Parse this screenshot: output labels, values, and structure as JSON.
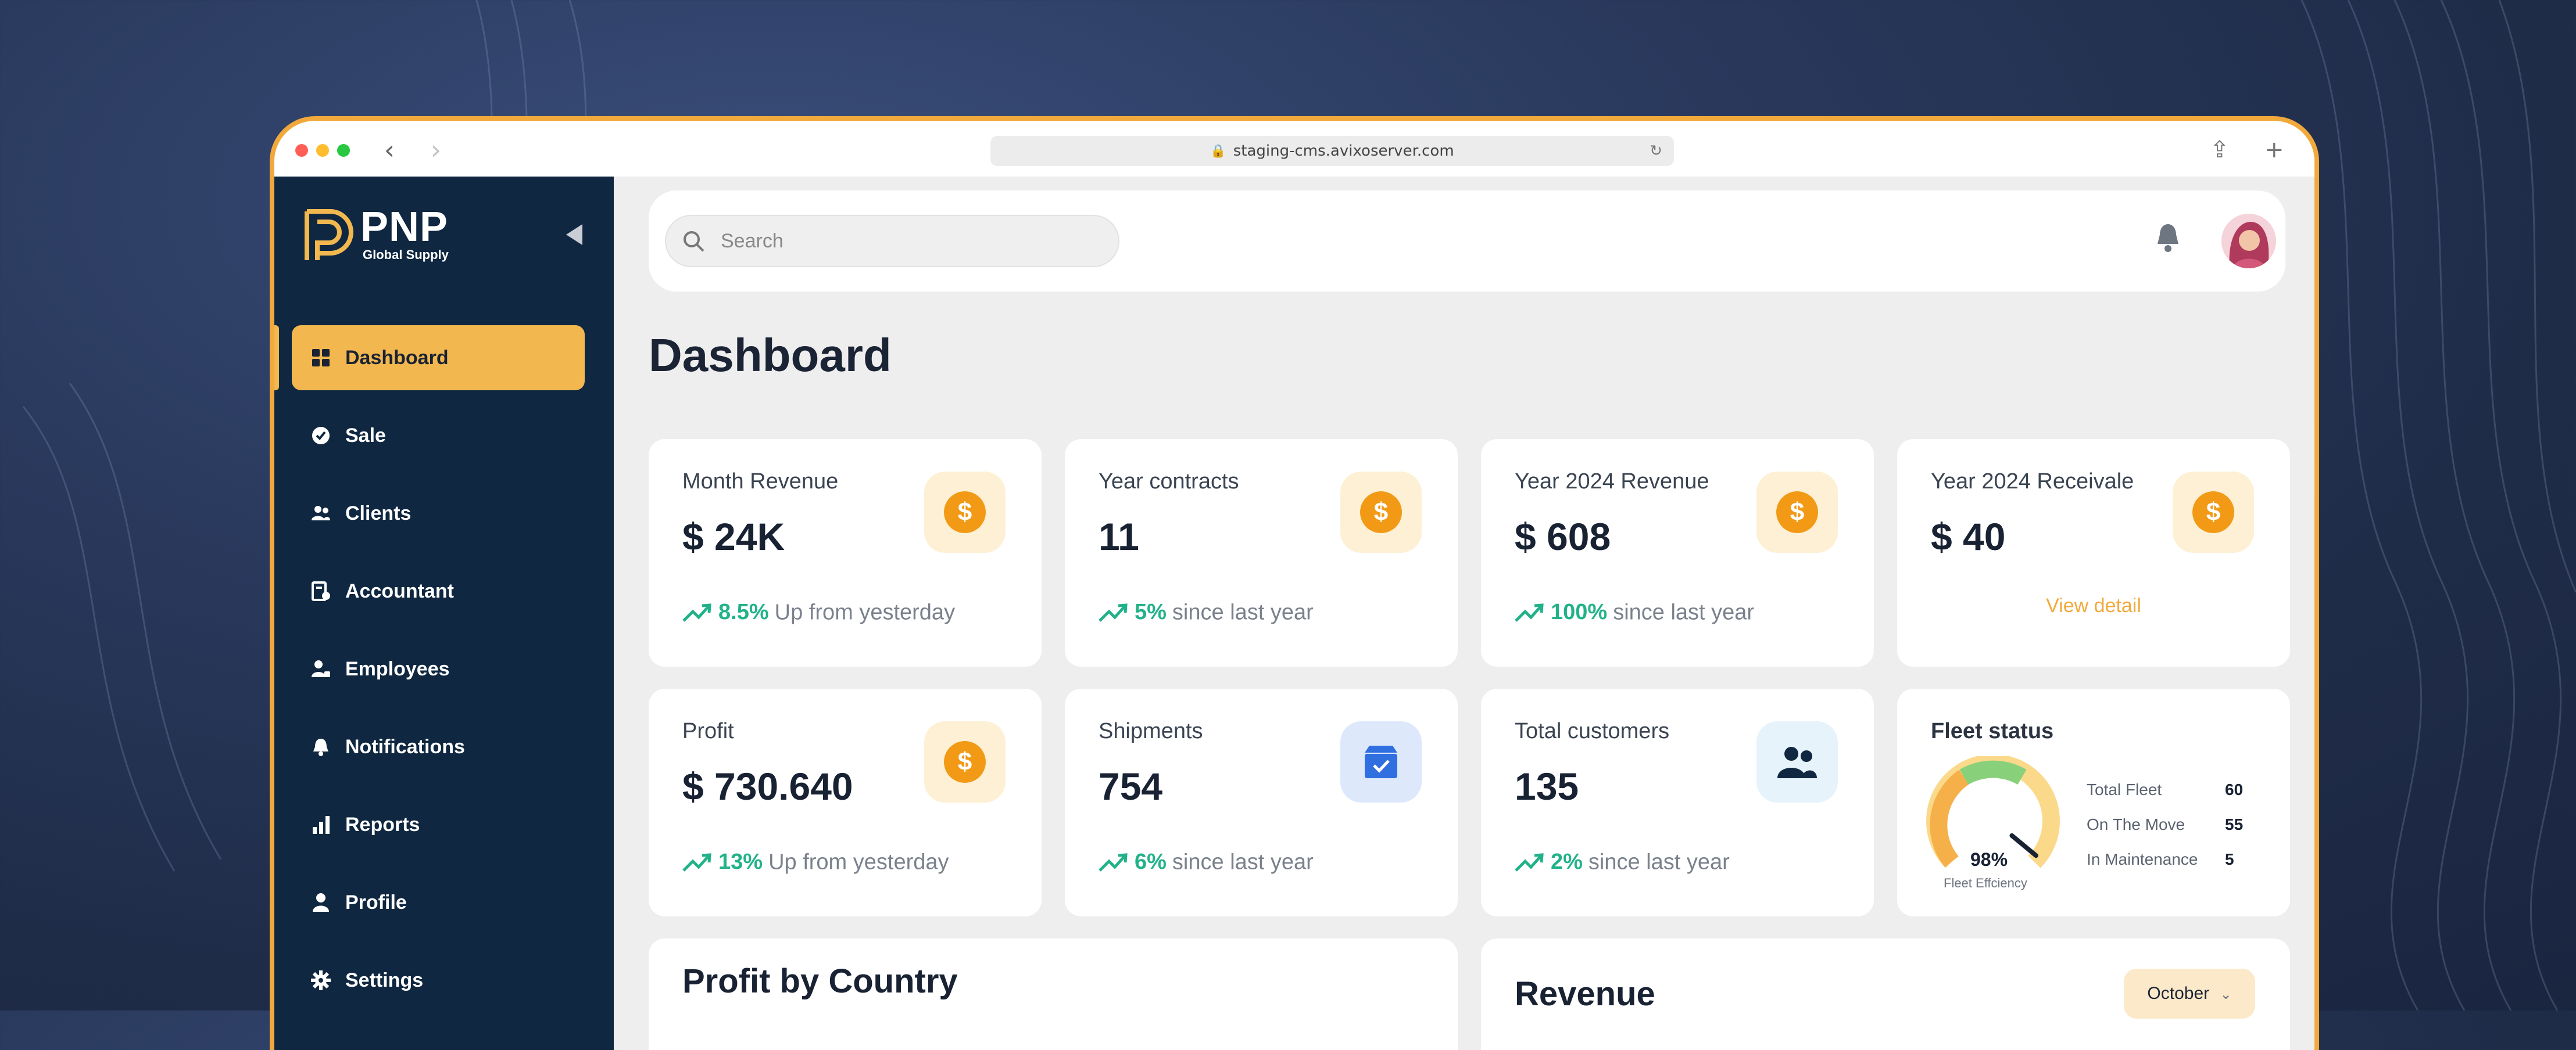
{
  "browser": {
    "url": "staging-cms.avixoserver.com",
    "traffic_colors": [
      "#ff5f57",
      "#febc2e",
      "#28c840"
    ],
    "back_icon": "chevron-left-icon",
    "forward_icon": "chevron-right-icon",
    "share_icon": "share-icon",
    "new_tab_icon": "plus-icon"
  },
  "brand": {
    "name": "PNP",
    "tagline": "Global Supply",
    "accent": "#f2b84f",
    "sidebar_bg": "#0f2740"
  },
  "sidebar": {
    "items": [
      {
        "label": "Dashboard",
        "icon": "grid-icon",
        "active": true
      },
      {
        "label": "Sale",
        "icon": "sale-icon",
        "active": false
      },
      {
        "label": "Clients",
        "icon": "users-icon",
        "active": false
      },
      {
        "label": "Accountant",
        "icon": "ledger-icon",
        "active": false
      },
      {
        "label": "Employees",
        "icon": "employee-icon",
        "active": false
      },
      {
        "label": "Notifications",
        "icon": "bell-icon",
        "active": false
      },
      {
        "label": "Reports",
        "icon": "bar-chart-icon",
        "active": false
      },
      {
        "label": "Profile",
        "icon": "person-icon",
        "active": false
      },
      {
        "label": "Settings",
        "icon": "gear-icon",
        "active": false
      }
    ]
  },
  "header": {
    "search_placeholder": "Search"
  },
  "page": {
    "title": "Dashboard"
  },
  "stats": [
    {
      "label": "Month Revenue",
      "value": "$ 24K",
      "pct": "8.5%",
      "trend_text": "Up from yesterday",
      "icon": "dollar-coin-icon"
    },
    {
      "label": "Year contracts",
      "value": "11",
      "pct": "5%",
      "trend_text": "since last year",
      "icon": "dollar-coin-icon"
    },
    {
      "label": "Year 2024 Revenue",
      "value": "$ 608",
      "pct": "100%",
      "trend_text": "since last year",
      "icon": "dollar-coin-icon"
    },
    {
      "label": "Year 2024 Receivale",
      "value": "$ 40",
      "link": "View detail",
      "icon": "dollar-coin-icon"
    },
    {
      "label": "Profit",
      "value": "$ 730.640",
      "pct": "13%",
      "trend_text": "Up from yesterday",
      "icon": "dollar-coin-icon"
    },
    {
      "label": "Shipments",
      "value": "754",
      "pct": "6%",
      "trend_text": "since last year",
      "icon": "package-icon"
    },
    {
      "label": "Total customers",
      "value": "135",
      "pct": "2%",
      "trend_text": "since last year",
      "icon": "customers-icon"
    }
  ],
  "fleet": {
    "title": "Fleet status",
    "efficiency": "98%",
    "efficiency_value": 0.98,
    "efficiency_label": "Fleet Effciency",
    "rows": [
      {
        "label": "Total Fleet",
        "value": "60"
      },
      {
        "label": "On The Move",
        "value": "55"
      },
      {
        "label": "In Maintenance",
        "value": "5"
      }
    ]
  },
  "sections": {
    "profit_by_country": "Profit by Country",
    "revenue": "Revenue",
    "revenue_month": "October"
  },
  "colors": {
    "positive": "#22b289",
    "coin": "#f29a16",
    "link": "#f2a93b"
  }
}
